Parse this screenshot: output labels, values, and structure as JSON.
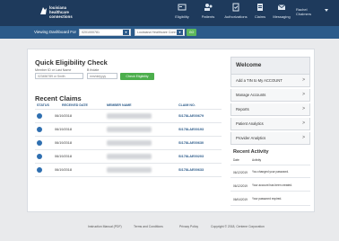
{
  "brand": {
    "line1": "louisiana",
    "line2": "healthcare",
    "line3": "connections"
  },
  "nav": [
    {
      "label": "Eligibility",
      "icon": "id-card-icon"
    },
    {
      "label": "Patients",
      "icon": "patients-icon"
    },
    {
      "label": "Authorizations",
      "icon": "authorizations-icon"
    },
    {
      "label": "Claims",
      "icon": "claims-icon"
    },
    {
      "label": "Messaging",
      "icon": "envelope-icon"
    }
  ],
  "user": {
    "line1": "Rachel",
    "line2": "Chalmers"
  },
  "subbar": {
    "label": "Viewing Dashboard For",
    "select1": "0201000781",
    "select2": "Louisiana Healthcare Conn",
    "go_label": "GO"
  },
  "qec": {
    "title": "Quick Eligibility Check",
    "member_label": "Member ID or Last Name",
    "dob_label": "B thdate",
    "member_value": "023456789 or Smith",
    "dob_placeholder": "mm/dd/yyyy",
    "button_label": "Check Eligibility"
  },
  "recent_claims": {
    "title": "Recent Claims",
    "headers": [
      "STATUS",
      "RECEIVED DATE",
      "MEMBER NAME",
      "CLAIM NO."
    ],
    "rows": [
      {
        "date": "06/19/2018",
        "claim": "SI178LAE00679"
      },
      {
        "date": "06/19/2018",
        "claim": "SI178LAE00193"
      },
      {
        "date": "06/19/2018",
        "claim": "SI178LAE00630"
      },
      {
        "date": "06/19/2018",
        "claim": "SI178LAE00203"
      },
      {
        "date": "06/19/2018",
        "claim": "SI178LAE00633"
      }
    ]
  },
  "welcome": {
    "title": "Welcome",
    "menu": [
      "Add a TIN to My ACCOUNT",
      "Manage Accounts",
      "Reports",
      "Patient Analytics",
      "Provider Analytics"
    ]
  },
  "recent_activity": {
    "title": "Recent Activity",
    "col_date": "Date",
    "col_activity": "Activity",
    "rows": [
      {
        "date": "06/12/2019",
        "text": "You changed your password."
      },
      {
        "date": "06/12/2019",
        "text": "Your account has been created."
      },
      {
        "date": "06/04/2019",
        "text": "Your password expired."
      }
    ]
  },
  "footer": {
    "links": [
      "Instruction Manual (PDF)",
      "Terms and Conditions",
      "Privacy Policy"
    ],
    "copyright": "Copyright © 2018, Centene Corporation"
  },
  "colors": {
    "header": "#1e3a5c",
    "subbar": "#2c5b8a",
    "accent_green": "#4cae4c",
    "status_dot": "#2f6fb0"
  }
}
